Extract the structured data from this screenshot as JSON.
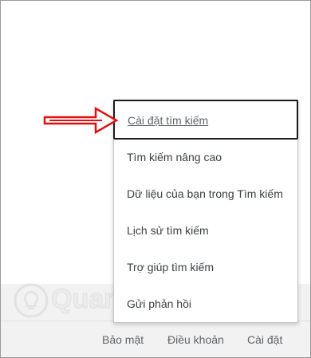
{
  "menu": {
    "items": [
      {
        "label": "Cài đặt tìm kiếm"
      },
      {
        "label": "Tìm kiếm nâng cao"
      },
      {
        "label": "Dữ liệu của bạn trong Tìm kiếm"
      },
      {
        "label": "Lịch sử tìm kiếm"
      },
      {
        "label": "Trợ giúp tìm kiếm"
      },
      {
        "label": "Gửi phản hồi"
      }
    ]
  },
  "footer": {
    "links": [
      {
        "label": "Bảo mật"
      },
      {
        "label": "Điều khoản"
      },
      {
        "label": "Cài đặt"
      }
    ]
  },
  "watermark": {
    "text": "Quantrimang",
    "icon": "lightbulb-icon"
  },
  "annotation": {
    "arrow_color": "#e01010"
  }
}
